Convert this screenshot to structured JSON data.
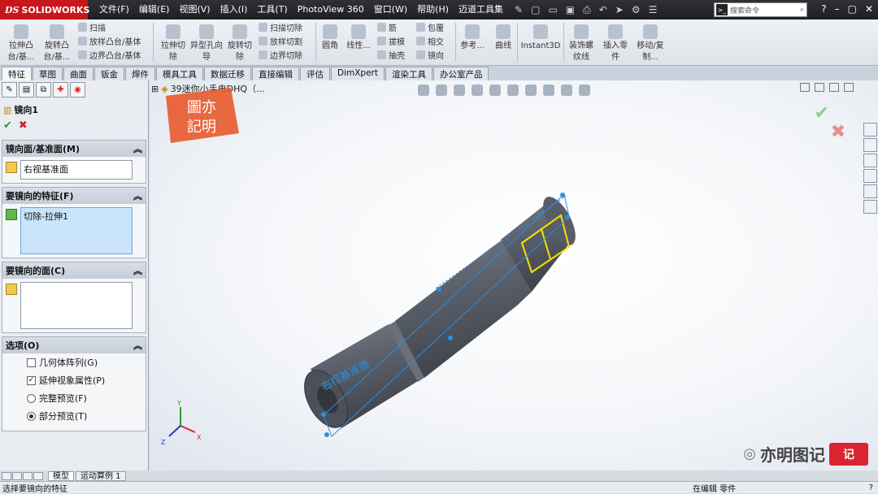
{
  "app": {
    "logo": "SOLIDWORKS",
    "logo_prefix": "DS"
  },
  "menu": [
    "文件(F)",
    "编辑(E)",
    "视图(V)",
    "插入(I)",
    "工具(T)",
    "PhotoView 360",
    "窗口(W)",
    "帮助(H)",
    "迈道工具集"
  ],
  "search": {
    "placeholder": "搜索命令"
  },
  "ribbon": {
    "big": [
      "拉伸凸台/基...",
      "旋转凸台/基...",
      "拉伸切除",
      "异型孔向导",
      "旋转切除",
      "圆角",
      "线性...",
      "参考...",
      "曲线",
      "Instant3D",
      "装饰螺纹线",
      "插入零件",
      "移动/复制..."
    ],
    "small": [
      "扫描",
      "放样凸台/基体",
      "边界凸台/基体",
      "扫描切除",
      "放样切割",
      "边界切除",
      "筋",
      "拔模",
      "抽壳",
      "包覆",
      "相交",
      "镜向"
    ]
  },
  "tabs": [
    "特征",
    "草图",
    "曲面",
    "钣金",
    "焊件",
    "模具工具",
    "数据迁移",
    "直接编辑",
    "评估",
    "DimXpert",
    "渲染工具",
    "办公室产品"
  ],
  "property_manager": {
    "title": "镜向1",
    "groups": {
      "mirror_face": {
        "label": "镜向面/基准面(M)",
        "value": "右视基准面"
      },
      "features": {
        "label": "要镜向的特征(F)",
        "value": "切除-拉伸1"
      },
      "faces": {
        "label": "要镜向的面(C)",
        "value": ""
      },
      "options": {
        "label": "选项(O)",
        "geometry_pattern": "几何体阵列(G)",
        "propagate": "延伸视象属性(P)",
        "full_preview": "完整预览(F)",
        "partial_preview": "部分预览(T)"
      }
    }
  },
  "viewport": {
    "tree_item": "39迷你小手电DHQ（...",
    "stamp_text": "图亦記明",
    "plane_label": "右视基准面",
    "watermark": "亦明图记",
    "watermark_logo": "记"
  },
  "bottom_tabs": [
    "模型",
    "运动算例 1"
  ],
  "status": {
    "message": "选择要镜向的特征",
    "mode": "在编辑 零件"
  },
  "colors": {
    "brand_red": "#c8161d",
    "body": "#5a5f69",
    "edge_blue": "#2a8fe0",
    "highlight_yellow": "#f4e300"
  }
}
